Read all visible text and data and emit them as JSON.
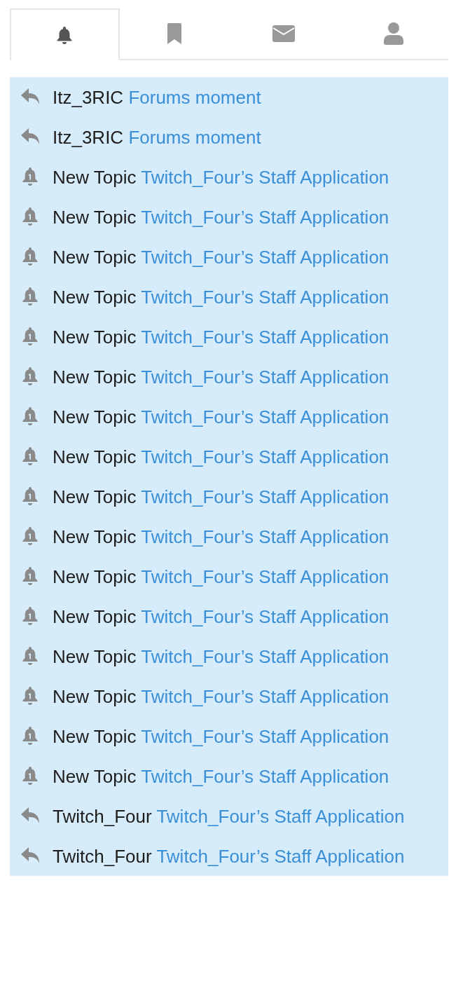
{
  "tabs": [
    {
      "kind": "bell",
      "selected": true
    },
    {
      "kind": "bookmark",
      "selected": false
    },
    {
      "kind": "envelope",
      "selected": false
    },
    {
      "kind": "user",
      "selected": false
    }
  ],
  "notifications": [
    {
      "kind": "reply",
      "actor": "Itz_3RIC",
      "link": "Forums moment"
    },
    {
      "kind": "reply",
      "actor": "Itz_3RIC",
      "link": "Forums moment"
    },
    {
      "kind": "topic",
      "actor": "New Topic",
      "link": "Twitch_Four’s Staff Application"
    },
    {
      "kind": "topic",
      "actor": "New Topic",
      "link": "Twitch_Four’s Staff Application"
    },
    {
      "kind": "topic",
      "actor": "New Topic",
      "link": "Twitch_Four’s Staff Application"
    },
    {
      "kind": "topic",
      "actor": "New Topic",
      "link": "Twitch_Four’s Staff Application"
    },
    {
      "kind": "topic",
      "actor": "New Topic",
      "link": "Twitch_Four’s Staff Application"
    },
    {
      "kind": "topic",
      "actor": "New Topic",
      "link": "Twitch_Four’s Staff Application"
    },
    {
      "kind": "topic",
      "actor": "New Topic",
      "link": "Twitch_Four’s Staff Application"
    },
    {
      "kind": "topic",
      "actor": "New Topic",
      "link": "Twitch_Four’s Staff Application"
    },
    {
      "kind": "topic",
      "actor": "New Topic",
      "link": "Twitch_Four’s Staff Application"
    },
    {
      "kind": "topic",
      "actor": "New Topic",
      "link": "Twitch_Four’s Staff Application"
    },
    {
      "kind": "topic",
      "actor": "New Topic",
      "link": "Twitch_Four’s Staff Application"
    },
    {
      "kind": "topic",
      "actor": "New Topic",
      "link": "Twitch_Four’s Staff Application"
    },
    {
      "kind": "topic",
      "actor": "New Topic",
      "link": "Twitch_Four’s Staff Application"
    },
    {
      "kind": "topic",
      "actor": "New Topic",
      "link": "Twitch_Four’s Staff Application"
    },
    {
      "kind": "topic",
      "actor": "New Topic",
      "link": "Twitch_Four’s Staff Application"
    },
    {
      "kind": "topic",
      "actor": "New Topic",
      "link": "Twitch_Four’s Staff Application"
    },
    {
      "kind": "reply",
      "actor": "Twitch_Four",
      "link": "Twitch_Four’s Staff Application"
    },
    {
      "kind": "reply",
      "actor": "Twitch_Four",
      "link": "Twitch_Four’s Staff Application"
    }
  ]
}
